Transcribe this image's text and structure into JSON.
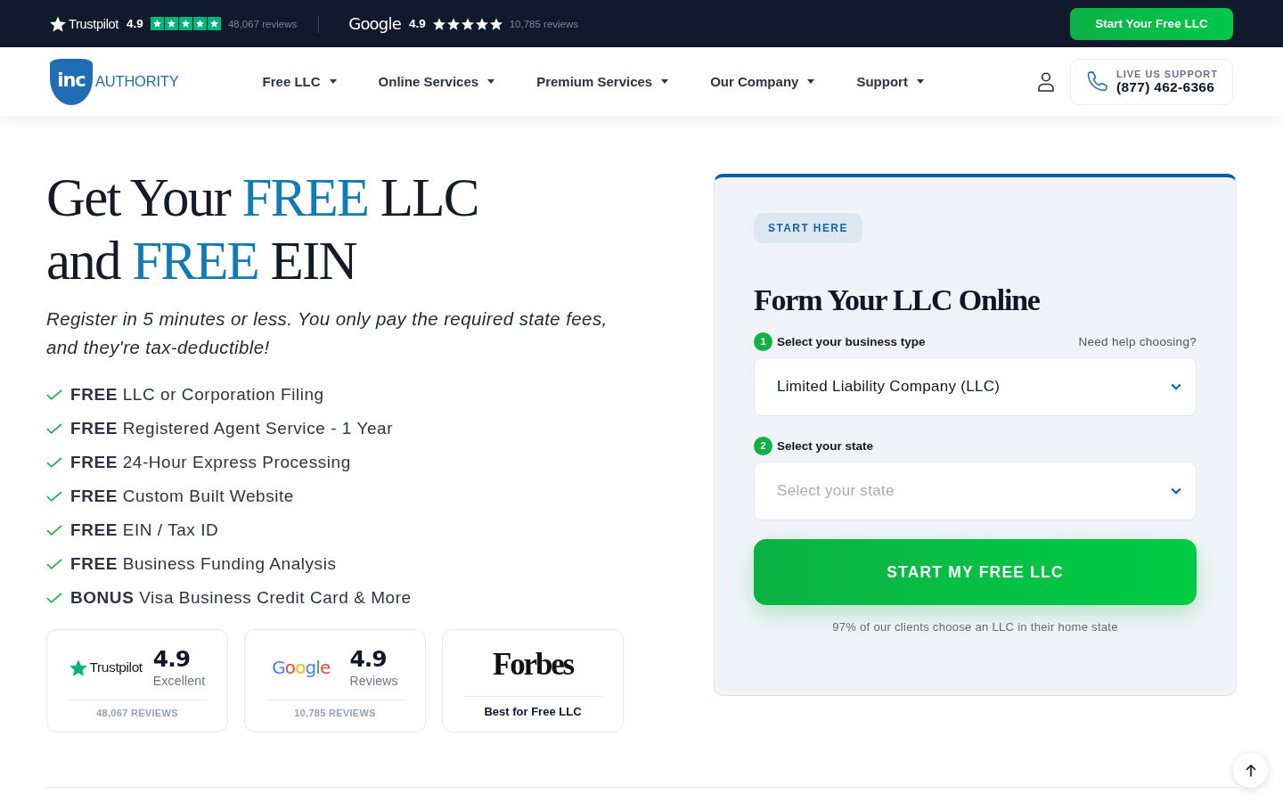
{
  "top_bar": {
    "ratings": [
      {
        "kind": "trustpilot",
        "brand": "Trustpilot",
        "score": "4.9",
        "stars": 5,
        "reviews": "48,067 reviews"
      },
      {
        "kind": "google",
        "brand": "Google",
        "score": "4.9",
        "stars": 5,
        "reviews": "10,785 reviews"
      }
    ],
    "cta": "Start Your Free LLC"
  },
  "nav": {
    "logo": {
      "mark": "inc",
      "name": "AUTHORITY"
    },
    "menu": [
      "Free LLC",
      "Online Services",
      "Premium Services",
      "Our Company",
      "Support"
    ],
    "support": {
      "label": "LIVE US SUPPORT",
      "phone": "(877) 462-6366"
    }
  },
  "hero": {
    "title": [
      [
        {
          "text": "Get Your ",
          "highlight": false
        },
        {
          "text": "FREE",
          "highlight": true
        },
        {
          "text": " LLC",
          "highlight": false
        }
      ],
      [
        {
          "text": "and ",
          "highlight": false
        },
        {
          "text": "FREE",
          "highlight": true
        },
        {
          "text": " EIN",
          "highlight": false
        }
      ]
    ],
    "subtitle": "Register in 5 minutes or less. You only pay the required state fees, and they're tax-deductible!",
    "features": [
      "**FREE** LLC or Corporation Filing",
      "**FREE** Registered Agent Service - 1 Year",
      "**FREE** 24-Hour Express Processing",
      "**FREE** Custom Built Website",
      "**FREE** EIN / Tax ID",
      "**FREE** Business Funding Analysis",
      "**BONUS** Visa Business Credit Card & More"
    ],
    "badges": [
      {
        "kind": "trustpilot",
        "brand": "Trustpilot",
        "score": "4.9",
        "caption": "Excellent",
        "footer": "48,067 REVIEWS"
      },
      {
        "kind": "google",
        "brand": "Google",
        "score": "4.9",
        "caption": "Reviews",
        "footer": "10,785 REVIEWS"
      },
      {
        "kind": "forbes",
        "brand": "Forbes",
        "footer": "Best for Free LLC"
      }
    ]
  },
  "form": {
    "badge": "START HERE",
    "title": "Form Your LLC Online",
    "steps": [
      {
        "number": "1",
        "label": "Select your business type",
        "help": "Need help choosing?",
        "value": "Limited Liability Company (LLC)"
      },
      {
        "number": "2",
        "label": "Select your state",
        "placeholder": "Select your state"
      }
    ],
    "button": "START MY FREE LLC",
    "note": "97% of our clients choose an LLC in their home state"
  }
}
